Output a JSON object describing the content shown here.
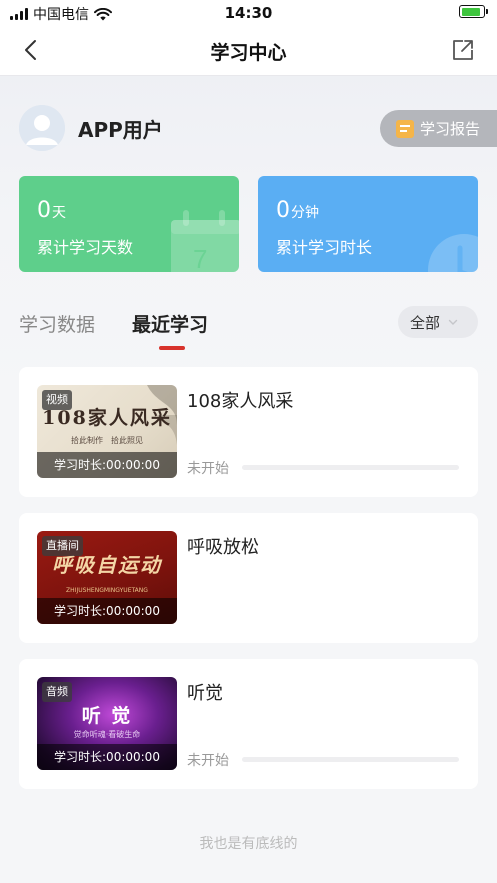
{
  "status_bar": {
    "carrier": "中国电信",
    "time": "14:30",
    "battery_level": 0.9
  },
  "nav": {
    "title": "学习中心",
    "back_icon": "chevron-left-icon",
    "share_icon": "share-icon"
  },
  "profile": {
    "username": "APP用户",
    "report_label": "学习报告"
  },
  "stats": {
    "days": {
      "value": "0",
      "unit": "天",
      "label": "累计学习天数",
      "color": "#5ecf8b"
    },
    "time": {
      "value": "0",
      "unit": "分钟",
      "label": "累计学习时长",
      "color": "#5aaef3"
    }
  },
  "tabs": {
    "data_label": "学习数据",
    "recent_label": "最近学习",
    "filter_label": "全部"
  },
  "courses": [
    {
      "badge": "视频",
      "art_title": "108家人风采",
      "art_sub": "拾此制作　拾此照见",
      "duration": "学习时长:00:00:00",
      "title": "108家人风采",
      "status": "未开始",
      "progress": 0
    },
    {
      "badge": "直播间",
      "art_title": "呼吸自运动",
      "art_sub": "ZHIJUSHENGMINGYUETANG",
      "duration": "学习时长:00:00:00",
      "title": "呼吸放松",
      "status": "",
      "progress": 0
    },
    {
      "badge": "音频",
      "art_title": "听 觉",
      "art_sub": "觉命听魂·看破生命",
      "duration": "学习时长:00:00:00",
      "title": "听觉",
      "status": "未开始",
      "progress": 0
    }
  ],
  "footer": {
    "text": "我也是有底线的"
  },
  "colors": {
    "accent": "#d8332c"
  }
}
